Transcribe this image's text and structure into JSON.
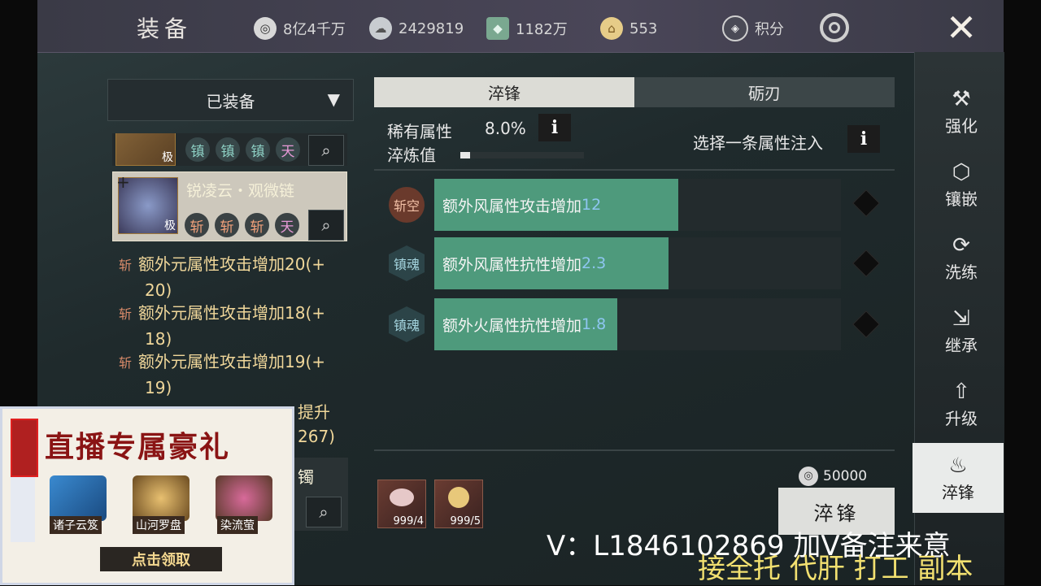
{
  "header": {
    "title": "装备",
    "resources": [
      {
        "icon": "coin-icon",
        "value": "8亿4千万"
      },
      {
        "icon": "silver-ingot-icon",
        "value": "2429819"
      },
      {
        "icon": "jade-icon",
        "value": "1182万"
      },
      {
        "icon": "gold-ingot-icon",
        "value": "553"
      }
    ],
    "points_label": "积分"
  },
  "left": {
    "dropdown_label": "已装备",
    "items": [
      {
        "grade": "极",
        "chips": [
          "镇",
          "镇",
          "镇",
          "天"
        ]
      },
      {
        "name": "锐凌云・观微链",
        "grade": "极",
        "plus": "+",
        "chips": [
          "斩",
          "斩",
          "斩",
          "天"
        ]
      }
    ],
    "attributes": [
      {
        "badge": "斩",
        "line1": "额外元属性攻击增加20(+",
        "line2": "20)"
      },
      {
        "badge": "斩",
        "line1": "额外元属性攻击增加18(+",
        "line2": "18)"
      },
      {
        "badge": "斩",
        "line1": "额外元属性攻击增加19(+",
        "line2": "19)"
      },
      {
        "line1": "提升",
        "line2": "267)"
      }
    ],
    "partial_item": "镯"
  },
  "tabs": [
    "淬锋",
    "砺刃"
  ],
  "panel": {
    "rare_attr_label": "稀有属性",
    "rare_attr_value": "8.0%",
    "temper_label": "淬炼值",
    "temper_progress": 0.08,
    "select_hint": "选择一条属性注入",
    "rows": [
      {
        "badge": "斩空",
        "text": "额外风属性攻击增加",
        "value": "12",
        "fill": 0.6
      },
      {
        "badge": "镇魂",
        "text": "额外风属性抗性增加",
        "value": "2.3",
        "fill": 0.575
      },
      {
        "badge": "镇魂",
        "text": "额外火属性抗性增加",
        "value": "1.8",
        "fill": 0.45
      }
    ]
  },
  "bottom": {
    "materials": [
      {
        "count": "999/4"
      },
      {
        "count": "999/5"
      }
    ],
    "cost": "50000",
    "action": "淬锋"
  },
  "nav": [
    {
      "icon": "hammer-icon",
      "label": "强化"
    },
    {
      "icon": "gem-icon",
      "label": "镶嵌"
    },
    {
      "icon": "refresh-icon",
      "label": "洗练"
    },
    {
      "icon": "inherit-icon",
      "label": "继承"
    },
    {
      "icon": "upgrade-icon",
      "label": "升级"
    },
    {
      "icon": "temper-icon",
      "label": "淬锋"
    }
  ],
  "overlay": {
    "title": "直播专属豪礼",
    "gifts": [
      "诸子云笈",
      "山河罗盘",
      "染流萤"
    ],
    "claim": "点击领取"
  },
  "watermark": {
    "line1": "V：L1846102869 加V备注来意",
    "line2": "接全托 代肝 打工 副本"
  }
}
